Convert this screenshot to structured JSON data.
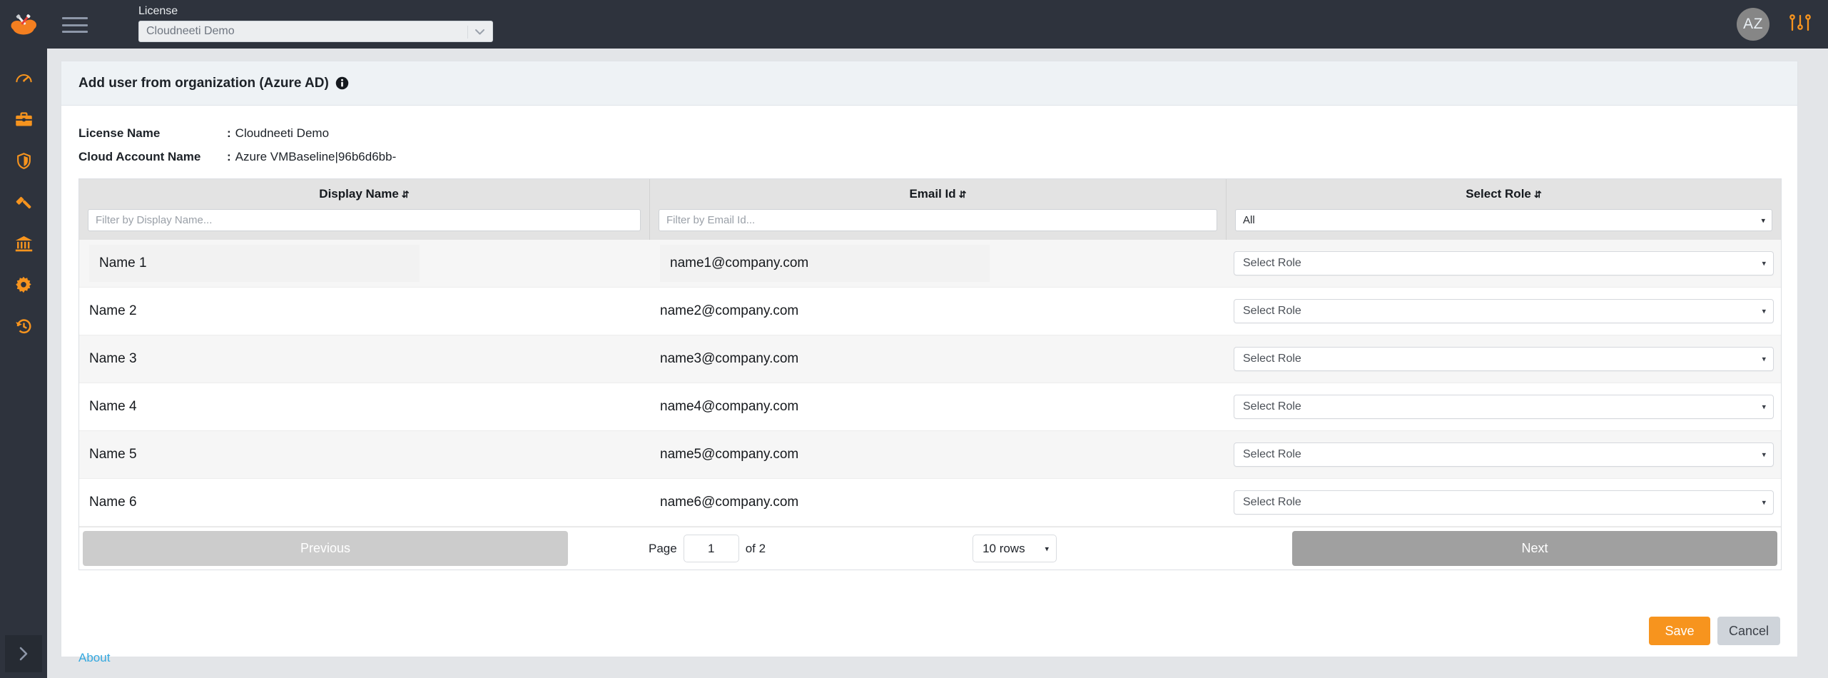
{
  "brand": {
    "accent": "#f7941e",
    "rail_bg": "#2e333d",
    "link": "#34a9e0"
  },
  "rail": {
    "logo_name": "cloud-tools-logo",
    "items": [
      {
        "icon": "gauge-icon",
        "label": "Dashboard"
      },
      {
        "icon": "briefcase-icon",
        "label": "Portfolio"
      },
      {
        "icon": "shield-icon",
        "label": "Security"
      },
      {
        "icon": "gavel-icon",
        "label": "Governance"
      },
      {
        "icon": "bank-icon",
        "label": "Compliance"
      },
      {
        "icon": "gear-icon",
        "label": "Settings"
      },
      {
        "icon": "history-icon",
        "label": "History"
      }
    ],
    "expand_label": "›"
  },
  "topbar": {
    "menu_icon": "hamburger-icon",
    "license_label": "License",
    "license_value": "Cloudneeti Demo",
    "avatar_initials": "AZ",
    "settings_icon": "sliders-icon"
  },
  "card": {
    "title": "Add user from organization (Azure AD)",
    "info_icon": "info-icon",
    "meta": [
      {
        "key": "License Name",
        "value": "Cloudneeti Demo"
      },
      {
        "key": "Cloud Account Name",
        "value": "Azure VMBaseline|96b6d6bb-"
      }
    ]
  },
  "table": {
    "columns": [
      {
        "title": "Display Name",
        "sort_glyph": "⇵",
        "filter_placeholder": "Filter by Display Name..."
      },
      {
        "title": "Email Id",
        "sort_glyph": "⇵",
        "filter_placeholder": "Filter by Email Id..."
      },
      {
        "title": "Select Role",
        "sort_glyph": "⇵",
        "filter_value": "All"
      }
    ],
    "role_placeholder": "Select Role",
    "dropdown_arrow": "▾",
    "rows": [
      {
        "name": "Name 1",
        "email": "name1@company.com",
        "role": "Select Role"
      },
      {
        "name": "Name 2",
        "email": "name2@company.com",
        "role": "Select Role"
      },
      {
        "name": "Name 3",
        "email": "name3@company.com",
        "role": "Select Role"
      },
      {
        "name": "Name 4",
        "email": "name4@company.com",
        "role": "Select Role"
      },
      {
        "name": "Name 5",
        "email": "name5@company.com",
        "role": "Select Role"
      },
      {
        "name": "Name 6",
        "email": "name6@company.com",
        "role": "Select Role"
      }
    ]
  },
  "pagination": {
    "previous_label": "Previous",
    "next_label": "Next",
    "page_word": "Page",
    "page_value": "1",
    "of_text": "of 2",
    "rows_per_page": "10 rows",
    "arrow": "▾"
  },
  "actions": {
    "save_label": "Save",
    "cancel_label": "Cancel",
    "about_label": "About"
  }
}
